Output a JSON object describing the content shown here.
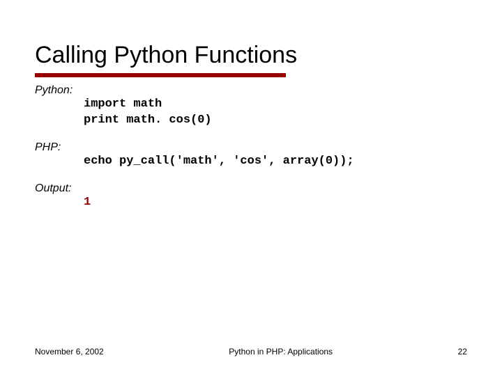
{
  "title": "Calling Python Functions",
  "sections": {
    "python": {
      "label": "Python:",
      "code_line1": "import math",
      "code_line2": "print math. cos(0)"
    },
    "php": {
      "label": "PHP:",
      "code_line1": "echo py_call('math', 'cos', array(0));"
    },
    "output": {
      "label": "Output:",
      "value": "1"
    }
  },
  "footer": {
    "date": "November 6, 2002",
    "center": "Python in PHP: Applications",
    "page": "22"
  },
  "colors": {
    "accent": "#9a0000"
  }
}
